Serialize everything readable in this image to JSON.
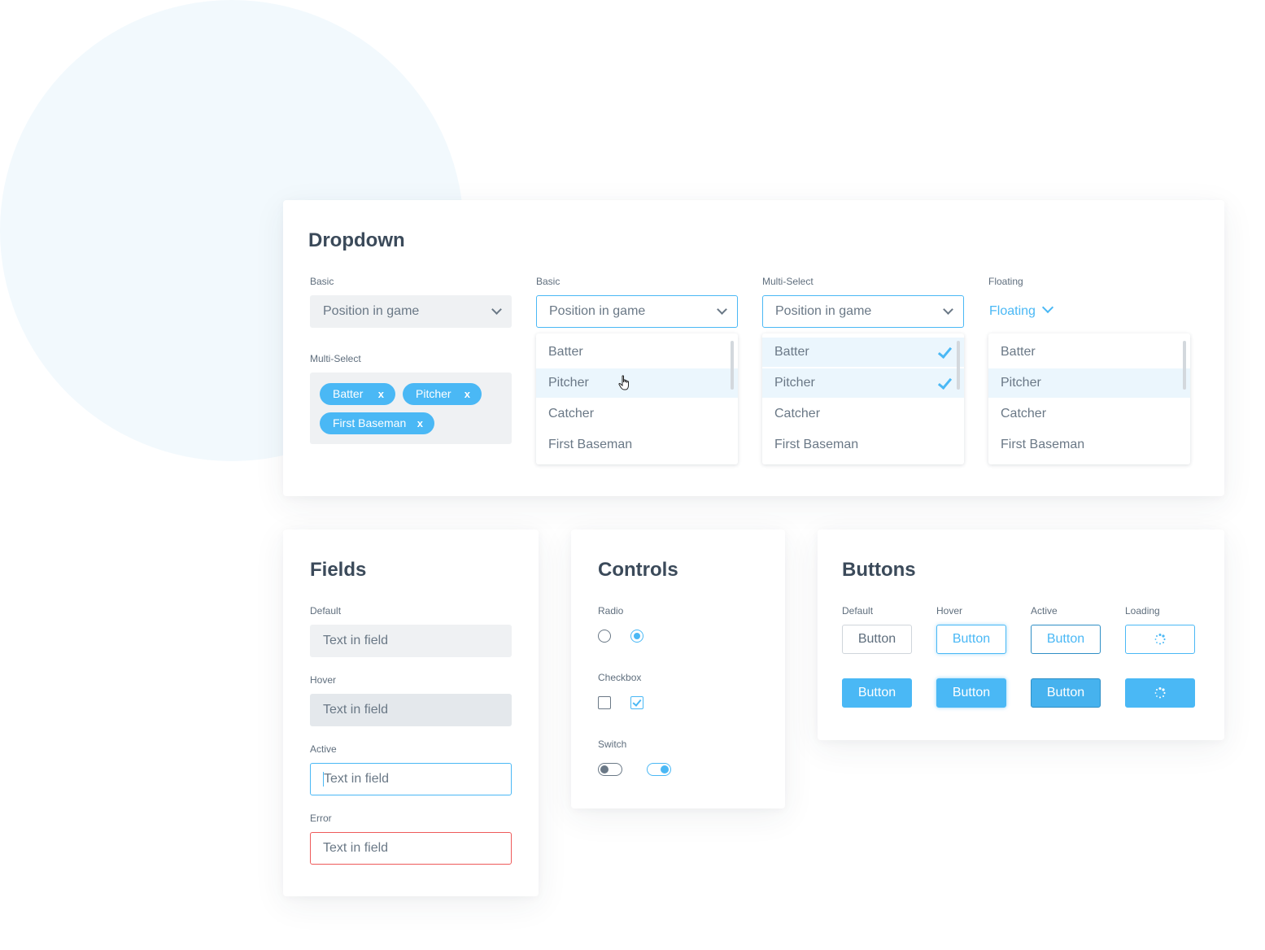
{
  "colors": {
    "accent": "#4ab8f5",
    "error": "#ee5a5a",
    "text": "#3b4a5a",
    "muted": "#6a7886",
    "field_bg": "#eff1f3",
    "highlight_bg": "#ebf6fd",
    "background_circle": "#f2f9fd"
  },
  "dropdown": {
    "title": "Dropdown",
    "basic_filled": {
      "label": "Basic",
      "value": "Position in game",
      "icon": "chevron-down-icon"
    },
    "multi_select_tags": {
      "label": "Multi-Select",
      "tags": [
        {
          "label": "Batter",
          "remove": "x"
        },
        {
          "label": "Pitcher",
          "remove": "x"
        },
        {
          "label": "First Baseman",
          "remove": "x"
        }
      ]
    },
    "basic_open": {
      "label": "Basic",
      "value": "Position in game",
      "options": [
        "Batter",
        "Pitcher",
        "Catcher",
        "First Baseman"
      ],
      "hovered": "Pitcher"
    },
    "multi_open": {
      "label": "Multi-Select",
      "value": "Position in game",
      "options": [
        "Batter",
        "Pitcher",
        "Catcher",
        "First Baseman"
      ],
      "checked": [
        "Batter",
        "Pitcher"
      ]
    },
    "floating": {
      "label": "Floating",
      "value": "Floating",
      "options": [
        "Batter",
        "Pitcher",
        "Catcher",
        "First Baseman"
      ],
      "hovered": "Pitcher"
    }
  },
  "fields": {
    "title": "Fields",
    "items": [
      {
        "label": "Default",
        "value": "Text in field",
        "state": "default"
      },
      {
        "label": "Hover",
        "value": "Text in field",
        "state": "hover"
      },
      {
        "label": "Active",
        "value": "Text in field",
        "state": "active"
      },
      {
        "label": "Error",
        "value": "Text in field",
        "state": "error"
      }
    ]
  },
  "controls": {
    "title": "Controls",
    "radio": {
      "label": "Radio",
      "states": [
        false,
        true
      ]
    },
    "checkbox": {
      "label": "Checkbox",
      "states": [
        false,
        true
      ]
    },
    "switch": {
      "label": "Switch",
      "states": [
        false,
        true
      ]
    }
  },
  "buttons": {
    "title": "Buttons",
    "columns": [
      "Default",
      "Hover",
      "Active",
      "Loading"
    ],
    "label": "Button"
  }
}
